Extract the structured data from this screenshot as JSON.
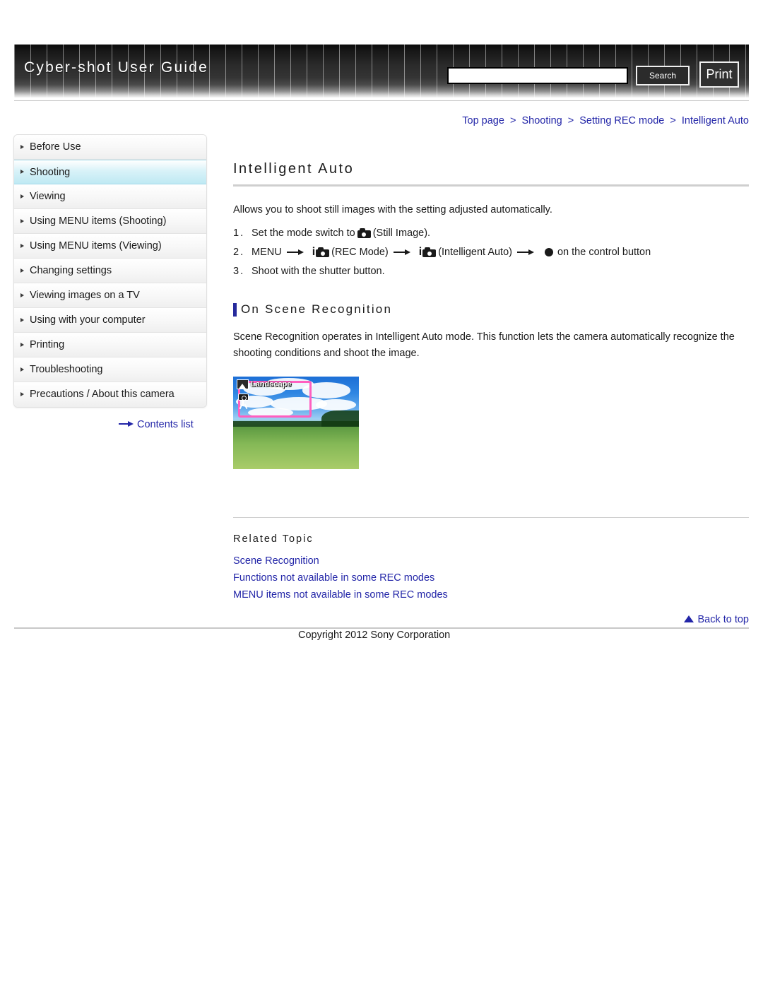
{
  "header": {
    "title": "Cyber-shot User Guide",
    "search_value": "",
    "search_placeholder": "",
    "search_label": "Search",
    "print_label": "Print"
  },
  "breadcrumb": {
    "items": [
      "Top page",
      "Shooting",
      "Setting REC mode",
      "Intelligent Auto"
    ],
    "separator": ">"
  },
  "sidebar": {
    "items": [
      {
        "label": "Before Use",
        "selected": false
      },
      {
        "label": "Shooting",
        "selected": true
      },
      {
        "label": "Viewing",
        "selected": false
      },
      {
        "label": "Using MENU items (Shooting)",
        "selected": false
      },
      {
        "label": "Using MENU items (Viewing)",
        "selected": false
      },
      {
        "label": "Changing settings",
        "selected": false
      },
      {
        "label": "Viewing images on a TV",
        "selected": false
      },
      {
        "label": "Using with your computer",
        "selected": false
      },
      {
        "label": "Printing",
        "selected": false
      },
      {
        "label": "Troubleshooting",
        "selected": false
      },
      {
        "label": "Precautions / About this camera",
        "selected": false
      }
    ],
    "contents_list_label": "Contents list"
  },
  "main": {
    "title": "Intelligent Auto",
    "intro": "Allows you to shoot still images with the setting adjusted automatically.",
    "steps": [
      {
        "num": "1.",
        "parts": [
          {
            "type": "text",
            "value": "Set the mode switch to "
          },
          {
            "type": "icon",
            "value": "camera-icon"
          },
          {
            "type": "text",
            "value": "(Still Image)."
          }
        ]
      },
      {
        "num": "2.",
        "parts": [
          {
            "type": "text",
            "value": "MENU"
          },
          {
            "type": "icon",
            "value": "arrow-right-icon"
          },
          {
            "type": "icon",
            "value": "i-camera-icon"
          },
          {
            "type": "text",
            "value": "(REC Mode)"
          },
          {
            "type": "icon",
            "value": "arrow-right-icon"
          },
          {
            "type": "icon",
            "value": "i-camera-icon"
          },
          {
            "type": "text",
            "value": "(Intelligent Auto)"
          },
          {
            "type": "icon",
            "value": "arrow-right-icon"
          },
          {
            "type": "icon",
            "value": "control-dot-icon"
          },
          {
            "type": "text",
            "value": "on the control button"
          }
        ]
      },
      {
        "num": "3.",
        "parts": [
          {
            "type": "text",
            "value": "Shoot with the shutter button."
          }
        ]
      }
    ],
    "step1_text_a": "Set the mode switch to ",
    "step1_text_b": "(Still Image).",
    "step2_menu": "MENU",
    "step2_rec_mode": "(REC Mode)",
    "step2_intelligent_auto": "(Intelligent Auto)",
    "step2_control": "on the control button",
    "step3_text": "Shoot with the shutter button.",
    "section_heading": "On Scene Recognition",
    "section_body": "Scene Recognition operates in Intelligent Auto mode. This function lets the camera automatically recognize the shooting conditions and shoot the image.",
    "photo_label": "Landscape",
    "related_topic_heading": "Related Topic",
    "related_links": [
      "Scene Recognition",
      "Functions not available in some REC modes",
      "MENU items not available in some REC modes"
    ]
  },
  "footer": {
    "back_to_top": "Back to top",
    "copyright": "Copyright 2012 Sony Corporation"
  },
  "colors": {
    "link": "#2326a8",
    "accent_bar": "#262a9c",
    "selected_nav": "#bfe9f3",
    "scene_box": "#ff5fc0"
  }
}
